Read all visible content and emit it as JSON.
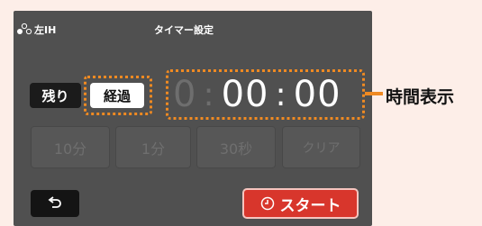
{
  "header": {
    "burner_label": "左IH",
    "title": "タイマー設定",
    "icon": "burner-dots-icon"
  },
  "mode": {
    "remaining_label": "残り",
    "elapsed_label": "経過",
    "selected": "elapsed"
  },
  "time": {
    "h": "0",
    "sep1": ":",
    "mm": "00",
    "sep2": ":",
    "ss": "00"
  },
  "annotation": {
    "label": "時間表示",
    "color": "#f08a22"
  },
  "quick_buttons": [
    {
      "label": "10分"
    },
    {
      "label": "1分"
    },
    {
      "label": "30秒"
    },
    {
      "label": "クリア"
    }
  ],
  "footer": {
    "back_icon": "back-arrow-icon",
    "start_label": "スタート",
    "start_icon": "clock-icon",
    "start_color": "#d8362c"
  }
}
